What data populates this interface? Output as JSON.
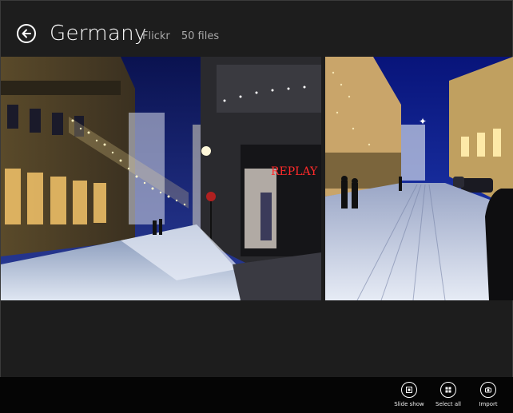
{
  "header": {
    "title": "Germany",
    "source": "Flickr",
    "count": "50 files"
  },
  "photos": [
    {
      "label": "photo-snowy-street-lights"
    },
    {
      "label": "photo-replay-store"
    },
    {
      "label": "photo-snowy-street-people"
    }
  ],
  "store_sign": "REPLAY",
  "appbar": {
    "commands": [
      {
        "label": "Slide show",
        "icon": "slideshow-icon"
      },
      {
        "label": "Select all",
        "icon": "select-all-icon"
      },
      {
        "label": "Import",
        "icon": "import-icon"
      }
    ]
  },
  "colors": {
    "background": "#1d1d1d",
    "appbar": "#050505",
    "subtitle": "#a8a8a8",
    "sky": "#14206e"
  }
}
